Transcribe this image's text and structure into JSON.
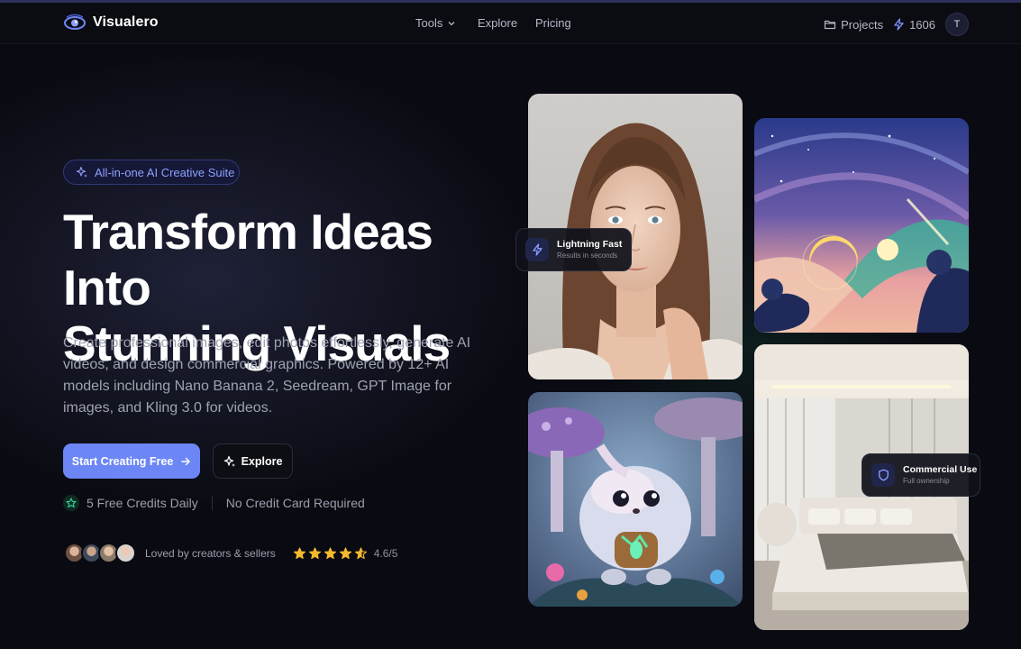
{
  "brand": {
    "name": "Visualero"
  },
  "nav": {
    "links": [
      "Tools",
      "Explore",
      "Pricing"
    ],
    "projects_label": "Projects",
    "credits": "1606",
    "avatar_initial": "T"
  },
  "hero": {
    "badge": "All-in-one AI Creative Suite",
    "title_line1": "Transform Ideas Into",
    "title_line2": "Stunning Visuals",
    "description": "Create professional images, edit photos effortlessly, generate AI videos, and design commercial graphics. Powered by 12+ AI models including Nano Banana 2, Seedream, GPT Image for images, and Kling 3.0 for videos.",
    "cta_primary": "Start Creating Free",
    "cta_secondary": "Explore",
    "perk1": "5 Free Credits Daily",
    "perk2": "No Credit Card Required",
    "social_text": "Loved by creators & sellers",
    "rating_value": 4.6,
    "rating_text": "4.6/5"
  },
  "chips": {
    "fast_title": "Lightning Fast",
    "fast_sub": "Results in seconds",
    "commercial_title": "Commercial Use",
    "commercial_sub": "Full ownership"
  },
  "icons": {
    "logo": "eye-logo-icon",
    "tools_chevron": "chevron-down-icon",
    "projects": "folder-icon",
    "credits": "lightning-icon",
    "badge": "sparkles-icon",
    "cta_primary": "arrow-right-icon",
    "cta_secondary": "sparkles-icon",
    "perk": "star-circle-icon",
    "chip_fast": "lightning-icon",
    "chip_commercial": "shield-icon"
  },
  "colors": {
    "accent": "#6d86f5",
    "badge_text": "#8ea0ff",
    "star": "#f5b92e",
    "background": "#0a0b12"
  }
}
